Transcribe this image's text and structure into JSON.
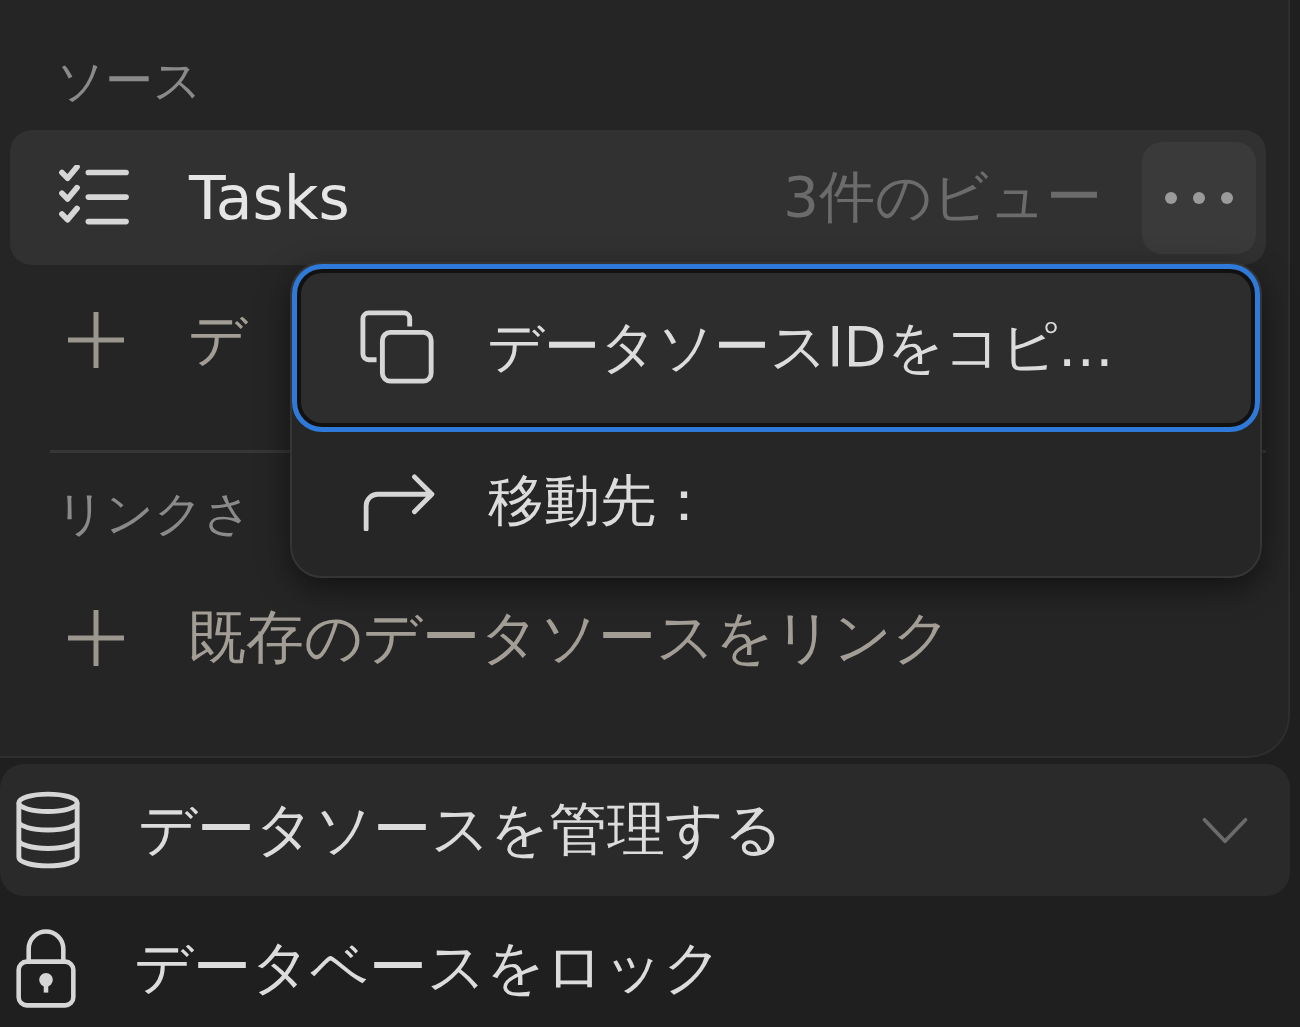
{
  "sources": {
    "heading": "ソース",
    "items": [
      {
        "name": "Tasks",
        "views": "3件のビュー",
        "selected": true
      }
    ],
    "add_label": "デ"
  },
  "linked": {
    "heading": "リンクさ",
    "add_label": "既存のデータソースをリンク"
  },
  "actions": [
    {
      "label": "データソースを管理する",
      "kind": "database",
      "expanded": false
    },
    {
      "label": "データベースをロック",
      "kind": "lock"
    }
  ],
  "menu": {
    "items": [
      {
        "label": "データソースIDをコピ…",
        "kind": "copy",
        "selected": true
      },
      {
        "label": "移動先：",
        "kind": "move",
        "selected": false
      }
    ]
  }
}
